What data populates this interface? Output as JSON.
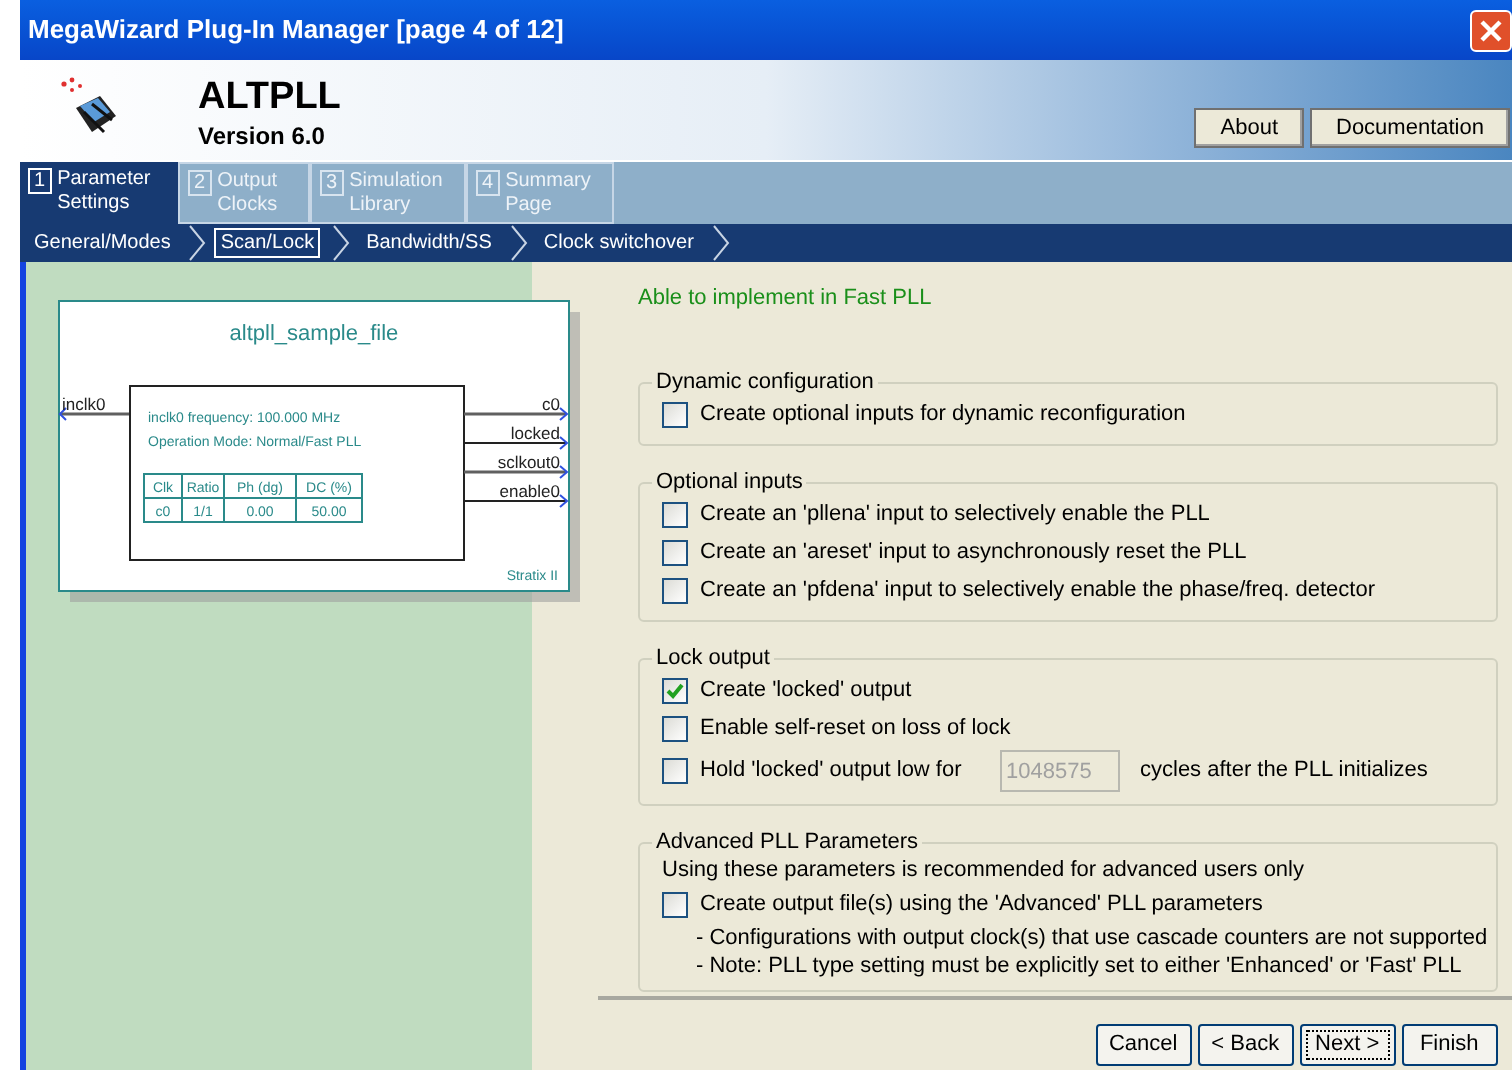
{
  "window": {
    "title": "MegaWizard Plug-In Manager [page 4 of 12]"
  },
  "header": {
    "name": "ALTPLL",
    "version": "Version 6.0",
    "buttons": [
      "About",
      "Documentation"
    ]
  },
  "steps": [
    {
      "number": "1",
      "label": "Parameter Settings",
      "selected": true
    },
    {
      "number": "2",
      "label": "Output Clocks",
      "selected": false
    },
    {
      "number": "3",
      "label": "Simulation Library",
      "selected": false
    },
    {
      "number": "4",
      "label": "Summary Page",
      "selected": false
    }
  ],
  "subtabs": [
    {
      "label": "General/Modes",
      "selected": false
    },
    {
      "label": "Scan/Lock",
      "selected": true
    },
    {
      "label": "Bandwidth/SS",
      "selected": false
    },
    {
      "label": "Clock switchover",
      "selected": false
    }
  ],
  "diagram": {
    "title": "altpll_sample_file",
    "input": "inclk0",
    "outputs": [
      "c0",
      "locked",
      "sclkout0",
      "enable0"
    ],
    "info": [
      "inclk0 frequency: 100.000 MHz",
      "Operation Mode: Normal/Fast PLL"
    ],
    "table": {
      "columns": [
        "Clk",
        "Ratio",
        "Ph (dg)",
        "DC (%)"
      ],
      "rows": [
        [
          "c0",
          "1/1",
          "0.00",
          "50.00"
        ]
      ]
    },
    "family": "Stratix II"
  },
  "status_message": "Able to implement in Fast PLL",
  "groups": [
    {
      "title": "Dynamic configuration",
      "items": [
        {
          "kind": "checkbox",
          "label": "Create optional inputs for dynamic reconfiguration",
          "checked": false
        }
      ]
    },
    {
      "title": "Optional inputs",
      "items": [
        {
          "kind": "checkbox",
          "label": "Create an 'pllena' input to selectively enable the PLL",
          "checked": false
        },
        {
          "kind": "checkbox",
          "label": "Create an 'areset' input to asynchronously reset the PLL",
          "checked": false
        },
        {
          "kind": "checkbox",
          "label": "Create an 'pfdena' input to selectively enable the phase/freq. detector",
          "checked": false
        }
      ]
    },
    {
      "title": "Lock output",
      "items": [
        {
          "kind": "checkbox",
          "label": "Create 'locked' output",
          "checked": true
        },
        {
          "kind": "checkbox",
          "label": "Enable self-reset on loss of lock",
          "checked": false
        },
        {
          "kind": "checkbox_field",
          "label": "Hold 'locked' output low for",
          "checked": false,
          "value": "1048575",
          "disabled": true,
          "suffix": "cycles after the PLL initializes"
        }
      ]
    },
    {
      "title": "Advanced PLL Parameters",
      "items": [
        {
          "kind": "text",
          "text": "Using these parameters is recommended for advanced users only"
        },
        {
          "kind": "checkbox",
          "label": "Create output file(s) using the 'Advanced' PLL parameters",
          "checked": false
        },
        {
          "kind": "note",
          "text": "- Configurations with output clock(s) that use cascade counters are not supported"
        },
        {
          "kind": "note",
          "text": "- Note: PLL type setting must be explicitly set to either 'Enhanced' or 'Fast' PLL"
        }
      ]
    }
  ],
  "buttons": [
    {
      "label": "Cancel",
      "focused": false
    },
    {
      "label": "< Back",
      "focused": false
    },
    {
      "label": "Next >",
      "focused": true
    },
    {
      "label": "Finish",
      "focused": false
    }
  ]
}
